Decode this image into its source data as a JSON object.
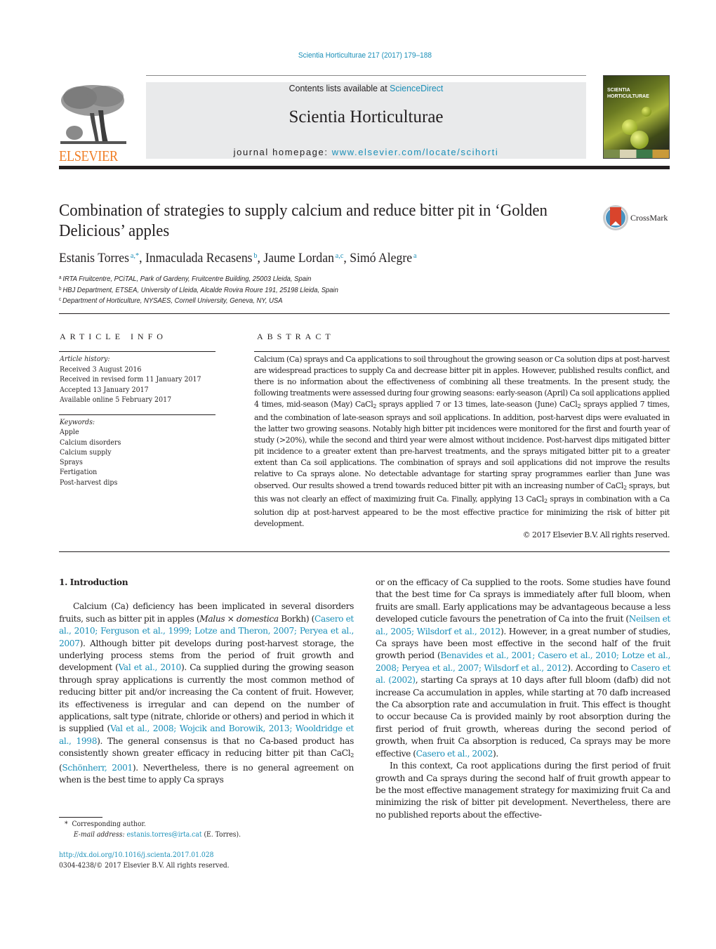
{
  "header": {
    "journal_ref": "Scientia Horticulturae 217 (2017) 179–188",
    "contents_prefix": "Contents lists available at ",
    "contents_link": "ScienceDirect",
    "journal_title": "Scientia Horticulturae",
    "homepage_prefix": "journal homepage: ",
    "homepage_link": "www.elsevier.com/locate/scihorti",
    "publisher_logo_text": "ELSEVIER",
    "cover_title": "SCIENTIA HORTICULTURAE",
    "icons": {
      "publisher": "elsevier-tree-logo",
      "cover": "journal-cover-image",
      "crossmark": "crossmark-icon"
    }
  },
  "article": {
    "title": "Combination of strategies to supply calcium and reduce bitter pit in ‘Golden Delicious’ apples",
    "crossmark_label": "CrossMark",
    "authors": [
      {
        "name": "Estanis Torres",
        "aff": "a,*"
      },
      {
        "name": "Inmaculada Recasens",
        "aff": "b"
      },
      {
        "name": "Jaume Lordan",
        "aff": "a,c"
      },
      {
        "name": "Simó Alegre",
        "aff": "a"
      }
    ],
    "affiliations": [
      {
        "mark": "a",
        "text": "IRTA Fruitcentre, PCiTAL, Park of Gardeny, Fruitcentre Building, 25003 Lleida, Spain"
      },
      {
        "mark": "b",
        "text": "HBJ Department, ETSEA, University of Lleida, Alcalde Rovira Roure 191, 25198 Lleida, Spain"
      },
      {
        "mark": "c",
        "text": "Department of Horticulture, NYSAES, Cornell University, Geneva, NY, USA"
      }
    ]
  },
  "article_info": {
    "heading": "ARTICLE INFO",
    "history_label": "Article history:",
    "history": [
      "Received 3 August 2016",
      "Received in revised form 11 January 2017",
      "Accepted 13 January 2017",
      "Available online 5 February 2017"
    ],
    "keywords_label": "Keywords:",
    "keywords": [
      "Apple",
      "Calcium disorders",
      "Calcium supply",
      "Sprays",
      "Fertigation",
      "Post-harvest dips"
    ]
  },
  "abstract": {
    "heading": "ABSTRACT",
    "segments": [
      "Calcium (Ca) sprays and Ca applications to soil throughout the growing season or Ca solution dips at post-harvest are widespread practices to supply Ca and decrease bitter pit in apples. However, published results conflict, and there is no information about the effectiveness of combining all these treatments. In the present study, the following treatments were assessed during four growing seasons: early-season (April) Ca soil applications applied 4 times, mid-season (May) CaCl",
      " sprays applied 7 or 13 times, late-season (June) CaCl",
      " sprays applied 7 times, and the combination of late-season sprays and soil applications. In addition, post-harvest dips were evaluated in the latter two growing seasons. Notably high bitter pit incidences were monitored for the first and fourth year of study (>20%), while the second and third year were almost without incidence. Post-harvest dips mitigated bitter pit incidence to a greater extent than pre-harvest treatments, and the sprays mitigated bitter pit to a greater extent than Ca soil applications. The combination of sprays and soil applications did not improve the results relative to Ca sprays alone. No detectable advantage for starting spray programmes earlier than June was observed. Our results showed a trend towards reduced bitter pit with an increasing number of CaCl",
      " sprays, but this was not clearly an effect of maximizing fruit Ca. Finally, applying 13 CaCl",
      " sprays in combination with a Ca solution dip at post-harvest appeared to be the most effective practice for minimizing the risk of bitter pit development."
    ],
    "subscript": "2",
    "copyright": "© 2017 Elsevier B.V. All rights reserved."
  },
  "introduction": {
    "heading": "1.  Introduction",
    "p1": {
      "t1": "Calcium (Ca) deficiency has been implicated in several disorders fruits, such as bitter pit in apples (",
      "species_genus": "Malus",
      "times": " × ",
      "species_epithet": "domestica",
      "t2": " Borkh) (",
      "c1": "Casero et al., 2010; Ferguson et al., 1999; Lotze and Theron, 2007; Peryea et al., 2007",
      "t3": "). Although bitter pit develops during post-harvest storage, the underlying process stems from the period of fruit growth and development (",
      "c2": "Val et al., 2010",
      "t4": "). Ca supplied during the growing season through spray applications is currently the most common method of reducing bitter pit and/or increasing the Ca content of fruit. However, its effectiveness is irregular and can depend on the number of applications, salt type (nitrate, chloride or others) and period in which it is supplied (",
      "c3": "Val et al., 2008; Wojcik and Borowik, 2013; Wooldridge et al., 1998",
      "t5": "). The general consensus is that no Ca-based product has consistently shown greater efficacy in reducing bitter pit than CaCl",
      "sub": "2",
      "t6": " (",
      "c4": "Schönherr, 2001",
      "t7": "). Nevertheless, there is no general agreement on when is the best time to apply Ca sprays or on the efficacy of Ca supplied to the roots. Some studies have found that the best time for Ca sprays is immediately after full bloom, when fruits are small. Early applications may be advantageous because a less developed cuticle favours the penetration of Ca into the fruit (",
      "c5": "Neilsen et al., 2005; Wilsdorf et al., 2012",
      "t8": "). However, in a great number of studies, Ca sprays have been most effective in the second half of the fruit growth period (",
      "c6": "Benavides et al., 2001; Casero et al., 2010; Lotze et al., 2008; Peryea et al., 2007; Wilsdorf et al., 2012",
      "t9": "). According to ",
      "c7": "Casero et al. (2002)",
      "t10": ", starting Ca sprays at 10 days after full bloom (dafb) did not increase Ca accumulation in apples, while starting at 70 dafb increased the Ca absorption rate and accumulation in fruit. This effect is thought to occur because Ca is provided mainly by root absorption during the first period of fruit growth, whereas during the second period of growth, when fruit Ca absorption is reduced, Ca sprays may be more effective (",
      "c8": "Casero et al., 2002",
      "t11": ")."
    },
    "p2": "In this context, Ca root applications during the first period of fruit growth and Ca sprays during the second half of fruit growth appear to be the most effective management strategy for maximizing fruit Ca and minimizing the risk of bitter pit development. Nevertheless, there are no published reports about the effective-"
  },
  "footnotes": {
    "star": "*",
    "corresponding": "Corresponding author.",
    "email_label": "E-mail address:",
    "email": "estanis.torres@irta.cat",
    "email_suffix": " (E. Torres).",
    "doi": "http://dx.doi.org/10.1016/j.scienta.2017.01.028",
    "issn_line": "0304-4238/© 2017 Elsevier B.V. All rights reserved."
  },
  "colors": {
    "link": "#1a8fb8",
    "publisher_orange": "#f07e26",
    "masthead_bg": "#e9eaeb",
    "text": "#231f20"
  }
}
